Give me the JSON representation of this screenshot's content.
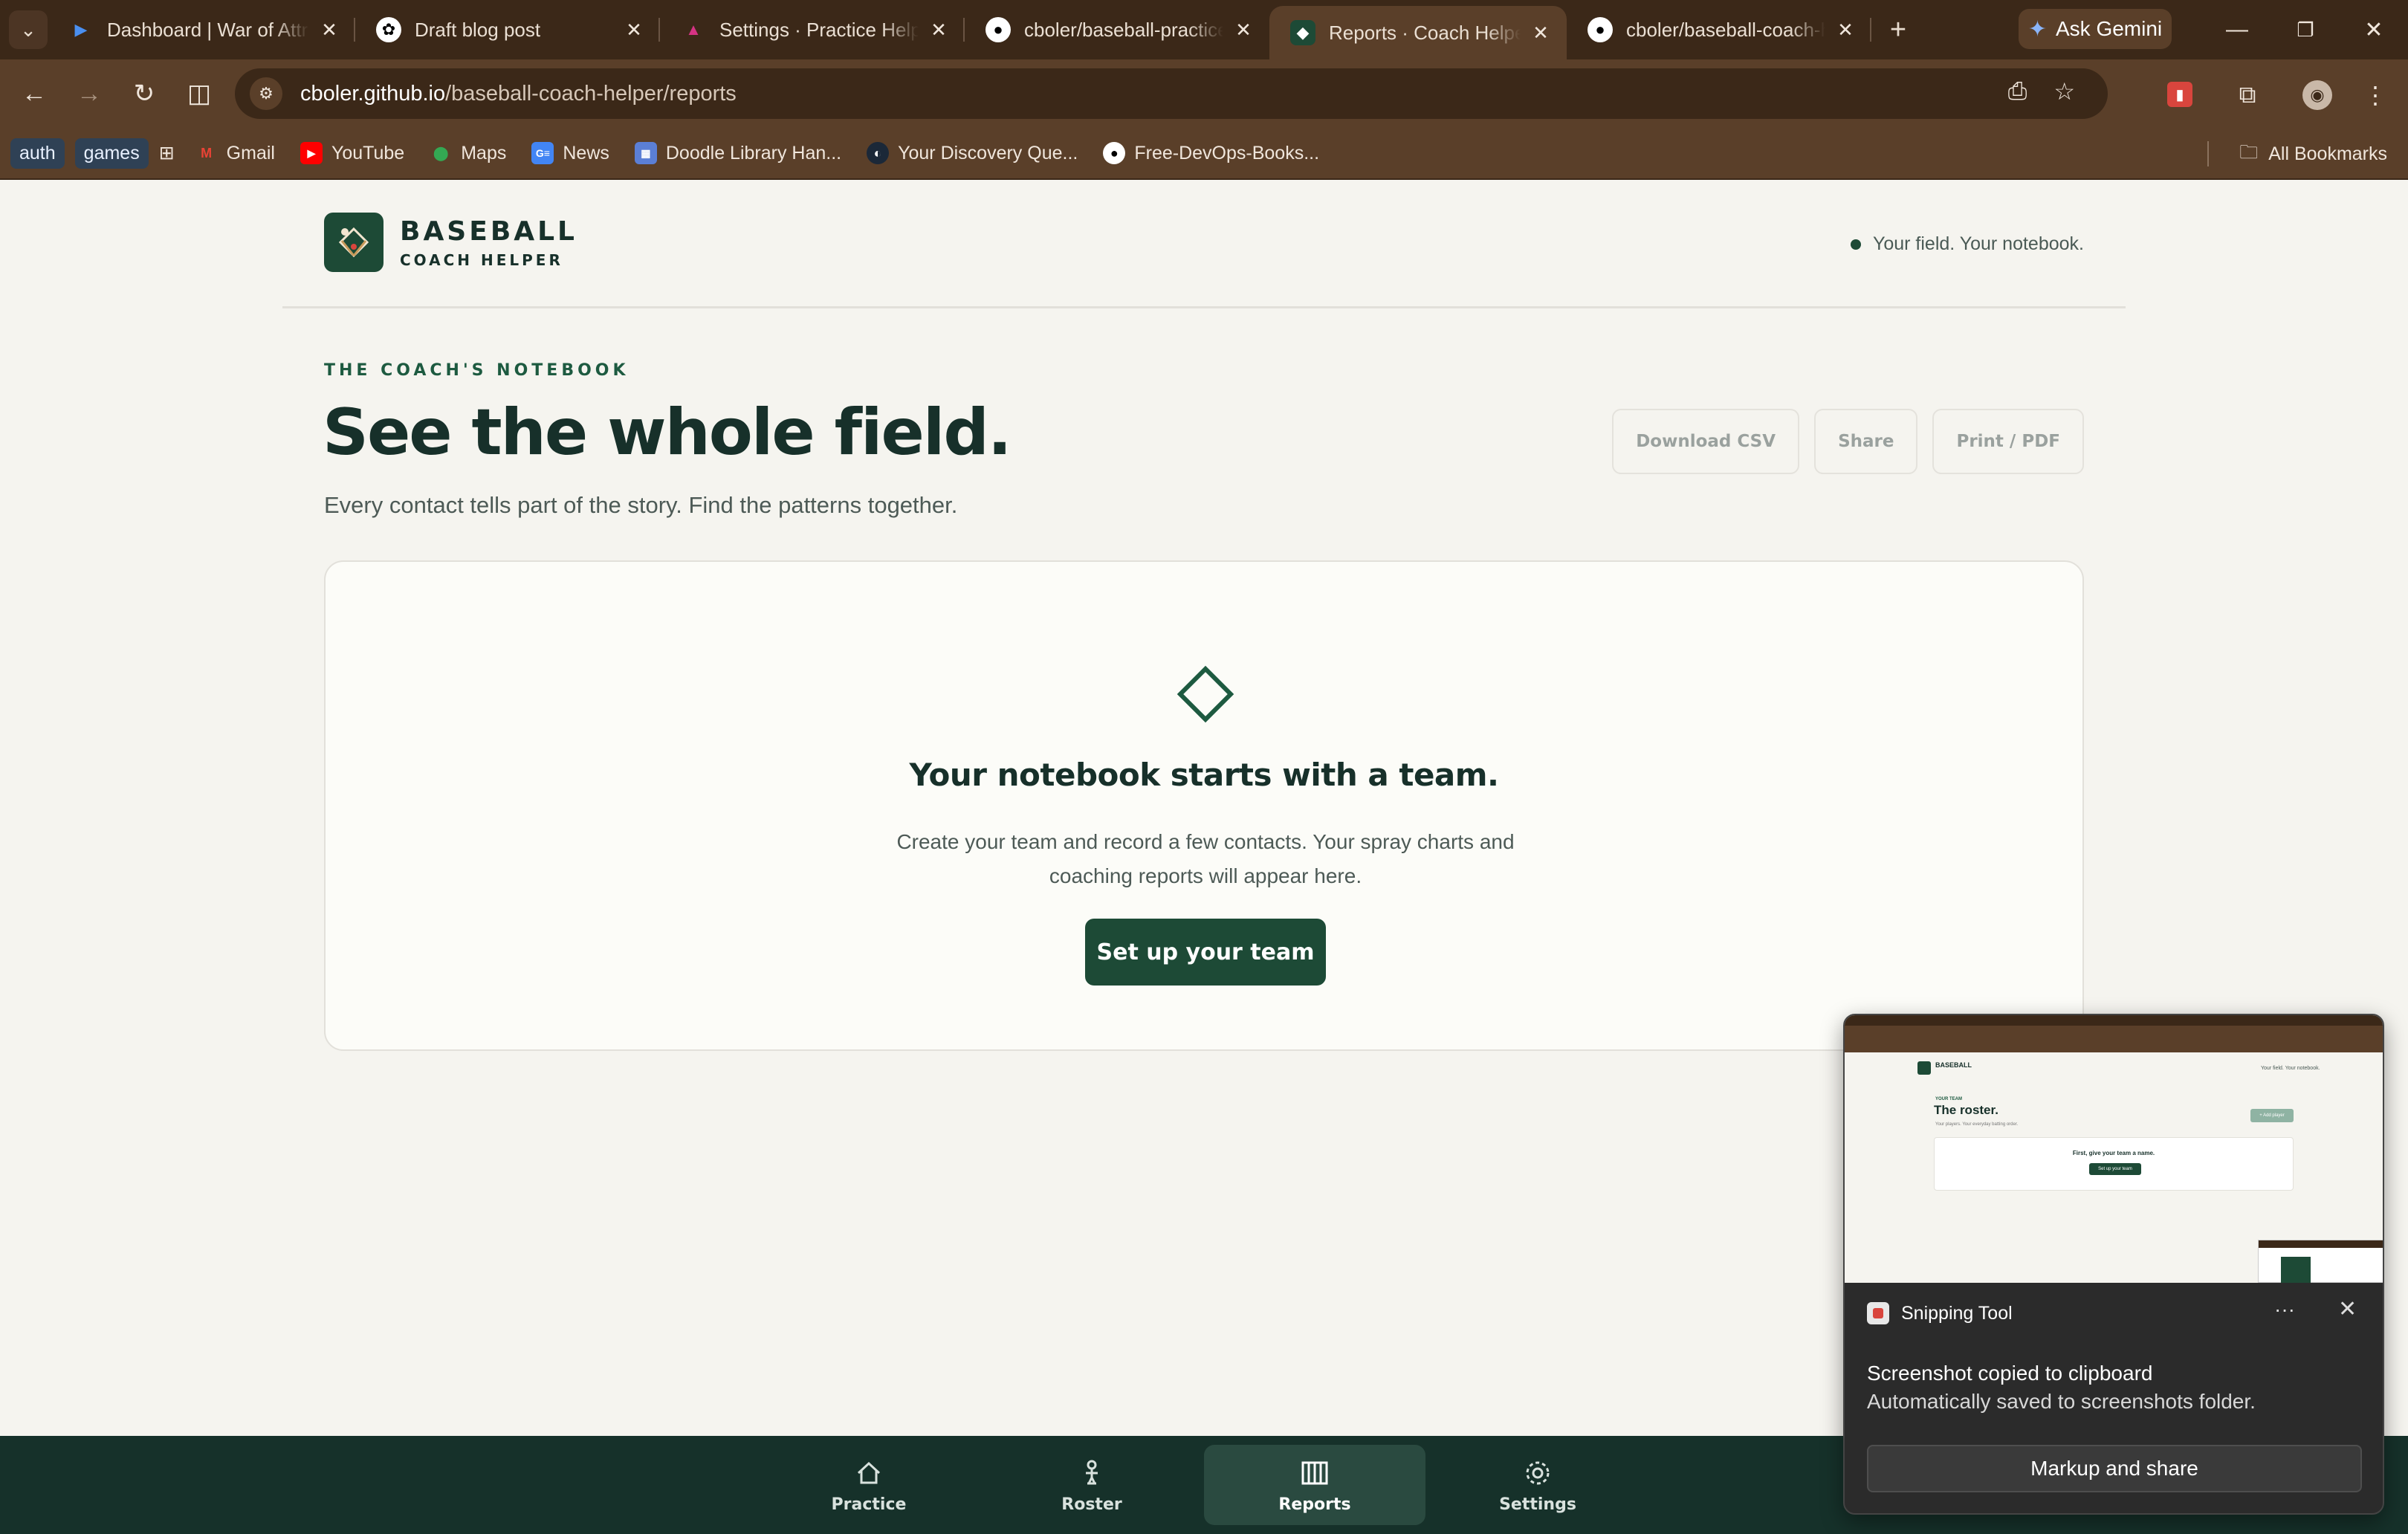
{
  "browser": {
    "tabs": [
      {
        "title": "Dashboard | War of Attrition",
        "favicon": "chevron-logo-icon",
        "color": "#4a8ff0"
      },
      {
        "title": "Draft blog post",
        "favicon": "openai-icon",
        "color": "#ffffff"
      },
      {
        "title": "Settings · Practice Helper",
        "favicon": "angular-icon",
        "color": "#d63384"
      },
      {
        "title": "cboler/baseball-practice-helper",
        "favicon": "github-icon",
        "color": "#ffffff"
      },
      {
        "title": "Reports · Coach Helper",
        "favicon": "coach-helper-icon",
        "color": "#1d4a36",
        "active": true
      },
      {
        "title": "cboler/baseball-coach-helper",
        "favicon": "github-icon",
        "color": "#ffffff"
      }
    ],
    "gemini_label": "Ask Gemini",
    "url_host": "cboler.github.io",
    "url_path": "/baseball-coach-helper/reports",
    "bookmarks": {
      "chips": [
        "auth",
        "games"
      ],
      "items": [
        {
          "label": "Gmail",
          "icon": "gmail-icon"
        },
        {
          "label": "YouTube",
          "icon": "youtube-icon"
        },
        {
          "label": "Maps",
          "icon": "maps-icon"
        },
        {
          "label": "News",
          "icon": "news-icon"
        },
        {
          "label": "Doodle Library Han...",
          "icon": "doodle-icon"
        },
        {
          "label": "Your Discovery Que...",
          "icon": "steam-icon"
        },
        {
          "label": "Free-DevOps-Books...",
          "icon": "github-icon"
        }
      ],
      "all_bookmarks": "All Bookmarks"
    }
  },
  "app": {
    "brand_name": "BASEBALL",
    "brand_sub": "COACH HELPER",
    "tagline": "Your field. Your notebook.",
    "eyebrow": "THE COACH'S NOTEBOOK",
    "headline": "See the whole field.",
    "lede": "Every contact tells part of the story. Find the patterns together.",
    "actions": [
      "Download CSV",
      "Share",
      "Print / PDF"
    ],
    "empty_state": {
      "title": "Your notebook starts with a team.",
      "body_line1": "Create your team and record a few contacts. Your spray charts and",
      "body_line2": "coaching reports will appear here.",
      "cta": "Set up your team"
    },
    "nav": [
      {
        "label": "Practice",
        "icon": "home-icon"
      },
      {
        "label": "Roster",
        "icon": "player-icon"
      },
      {
        "label": "Reports",
        "icon": "columns-icon",
        "active": true
      },
      {
        "label": "Settings",
        "icon": "gear-icon"
      }
    ],
    "accent": "#1d4a36"
  },
  "toast": {
    "app": "Snipping Tool",
    "line1": "Screenshot copied to clipboard",
    "line2": "Automatically saved to screenshots folder.",
    "button": "Markup and share",
    "thumb": {
      "brand": "BASEBALL",
      "tagline": "Your field. Your notebook.",
      "eyebrow": "YOUR TEAM",
      "headline": "The roster.",
      "sub": "Your players. Your everyday batting order.",
      "add": "+ Add player",
      "card_title": "First, give your team a name.",
      "card_btn": "Set up your team"
    }
  }
}
